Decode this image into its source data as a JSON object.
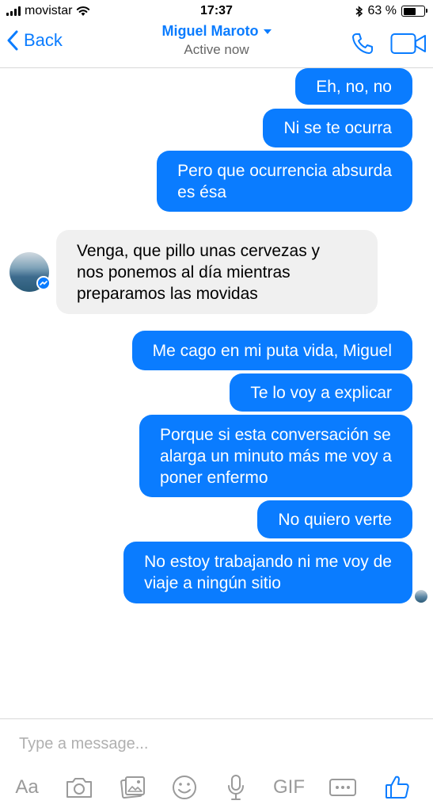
{
  "status_bar": {
    "carrier": "movistar",
    "time": "17:37",
    "battery_percent": "63 %",
    "battery_level": 0.63
  },
  "nav": {
    "back_label": "Back",
    "contact_name": "Miguel Maroto",
    "contact_status": "Active now",
    "accent_color": "#0a7cff"
  },
  "messages": [
    {
      "direction": "outgoing",
      "text": "Eh, no, no"
    },
    {
      "direction": "outgoing",
      "text": "Ni se te ocurra"
    },
    {
      "direction": "outgoing",
      "lines": [
        "Pero que ocurrencia absurda",
        "es ésa"
      ]
    },
    {
      "direction": "incoming",
      "lines": [
        "Venga, que pillo unas cervezas y",
        "nos ponemos al día mientras",
        "preparamos las movidas"
      ]
    },
    {
      "direction": "outgoing",
      "text": "Me cago en mi puta vida, Miguel"
    },
    {
      "direction": "outgoing",
      "text": "Te lo voy a explicar"
    },
    {
      "direction": "outgoing",
      "lines": [
        "Porque si esta conversación se",
        "alarga un minuto más me voy a",
        "poner enfermo"
      ]
    },
    {
      "direction": "outgoing",
      "text": "No quiero verte"
    },
    {
      "direction": "outgoing",
      "lines": [
        "No estoy trabajando ni me voy de",
        "viaje a ningún sitio"
      ]
    }
  ],
  "composer": {
    "placeholder": "Type a message...",
    "aa_label": "Aa",
    "gif_label": "GIF",
    "icons": [
      "camera-icon",
      "photo-gallery-icon",
      "emoji-icon",
      "microphone-icon",
      "more-options-icon",
      "thumbs-up-icon"
    ]
  }
}
